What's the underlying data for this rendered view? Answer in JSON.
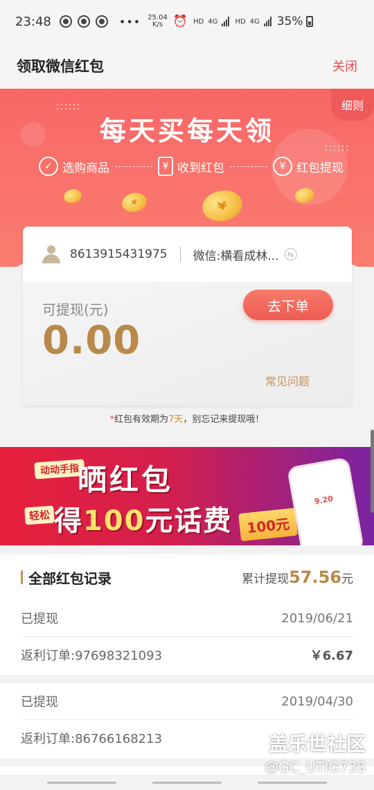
{
  "status": {
    "time": "23:48",
    "speed_value": "25.04",
    "speed_unit": "K/s",
    "hd1": "HD",
    "net1": "4G",
    "hd2": "HD",
    "net2": "4G",
    "battery": "35%"
  },
  "header": {
    "title": "领取微信红包",
    "close_label": "关闭"
  },
  "hero": {
    "rules_label": "细则",
    "slogan": "每天买每天领",
    "steps": [
      {
        "label": "选购商品",
        "icon": "check-circle-icon"
      },
      {
        "label": "收到红包",
        "icon": "envelope-icon"
      },
      {
        "label": "红包提现",
        "icon": "yuan-cycle-icon"
      }
    ]
  },
  "card": {
    "phone": "8613915431975",
    "wechat": "微信:横看成林...",
    "withdrawable_label": "可提现(元)",
    "amount": "0.00",
    "order_button": "去下单",
    "faq_link": "常见问题"
  },
  "note": {
    "star": "*",
    "prefix": "红包有效期为",
    "days": "7天",
    "suffix": "，别忘记来提现哦！"
  },
  "banner": {
    "tag1": "动动手指",
    "headline1": "晒红包",
    "tag2": "轻松",
    "headline2_pre": "得",
    "headline2_num": "100",
    "headline2_post": "元话费",
    "phone_value": "9.20",
    "ticket_value": "100元"
  },
  "records": {
    "title": "全部红包记录",
    "total_label": "累计提现",
    "total_value": "57.56",
    "total_unit": "元",
    "items": [
      {
        "status": "已提现",
        "date": "2019/06/21",
        "order": "返利订单:97698321093",
        "amount": "￥6.67"
      },
      {
        "status": "已提现",
        "date": "2019/04/30",
        "order": "返利订单:86766168213",
        "amount": ""
      }
    ]
  },
  "watermark": {
    "line1": "盖乐世社区",
    "line2": "@GC_UTIG73S"
  }
}
